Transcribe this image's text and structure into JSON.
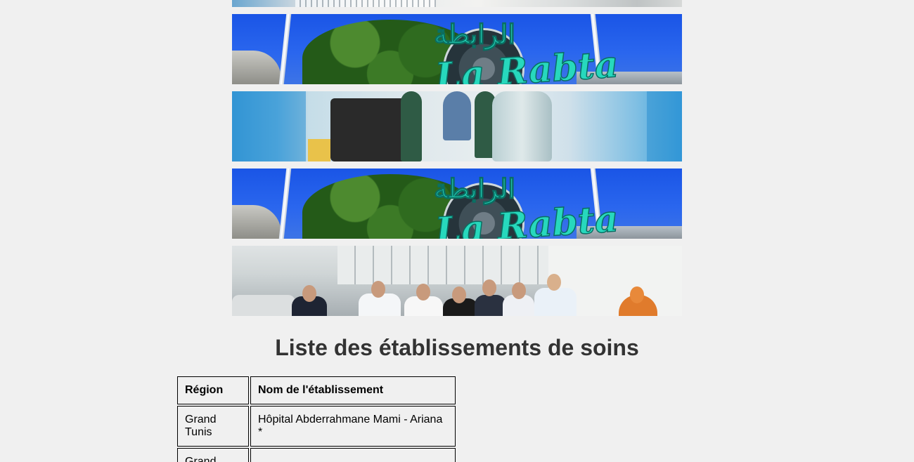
{
  "banners": [
    {
      "id": "building-sliver",
      "description_icon": "hospital-photo-icon"
    },
    {
      "id": "la-rabta-sign",
      "description_icon": "hospital-sign-photo-icon"
    },
    {
      "id": "corridor",
      "description_icon": "hospital-corridor-photo-icon"
    },
    {
      "id": "la-rabta-sign-2",
      "description_icon": "hospital-sign-photo-icon"
    },
    {
      "id": "staff-group",
      "description_icon": "medical-staff-photo-icon"
    }
  ],
  "sign_text": {
    "latin": "La Rabta",
    "arabic": "الرابطة"
  },
  "page": {
    "title": "Liste des établissements de soins"
  },
  "table": {
    "headers": {
      "region": "Région",
      "name": "Nom de l'établissement"
    },
    "rows": [
      {
        "region": "Grand Tunis",
        "name": "Hôpital Abderrahmane Mami - Ariana *"
      },
      {
        "region": "Grand",
        "name": ""
      }
    ]
  }
}
